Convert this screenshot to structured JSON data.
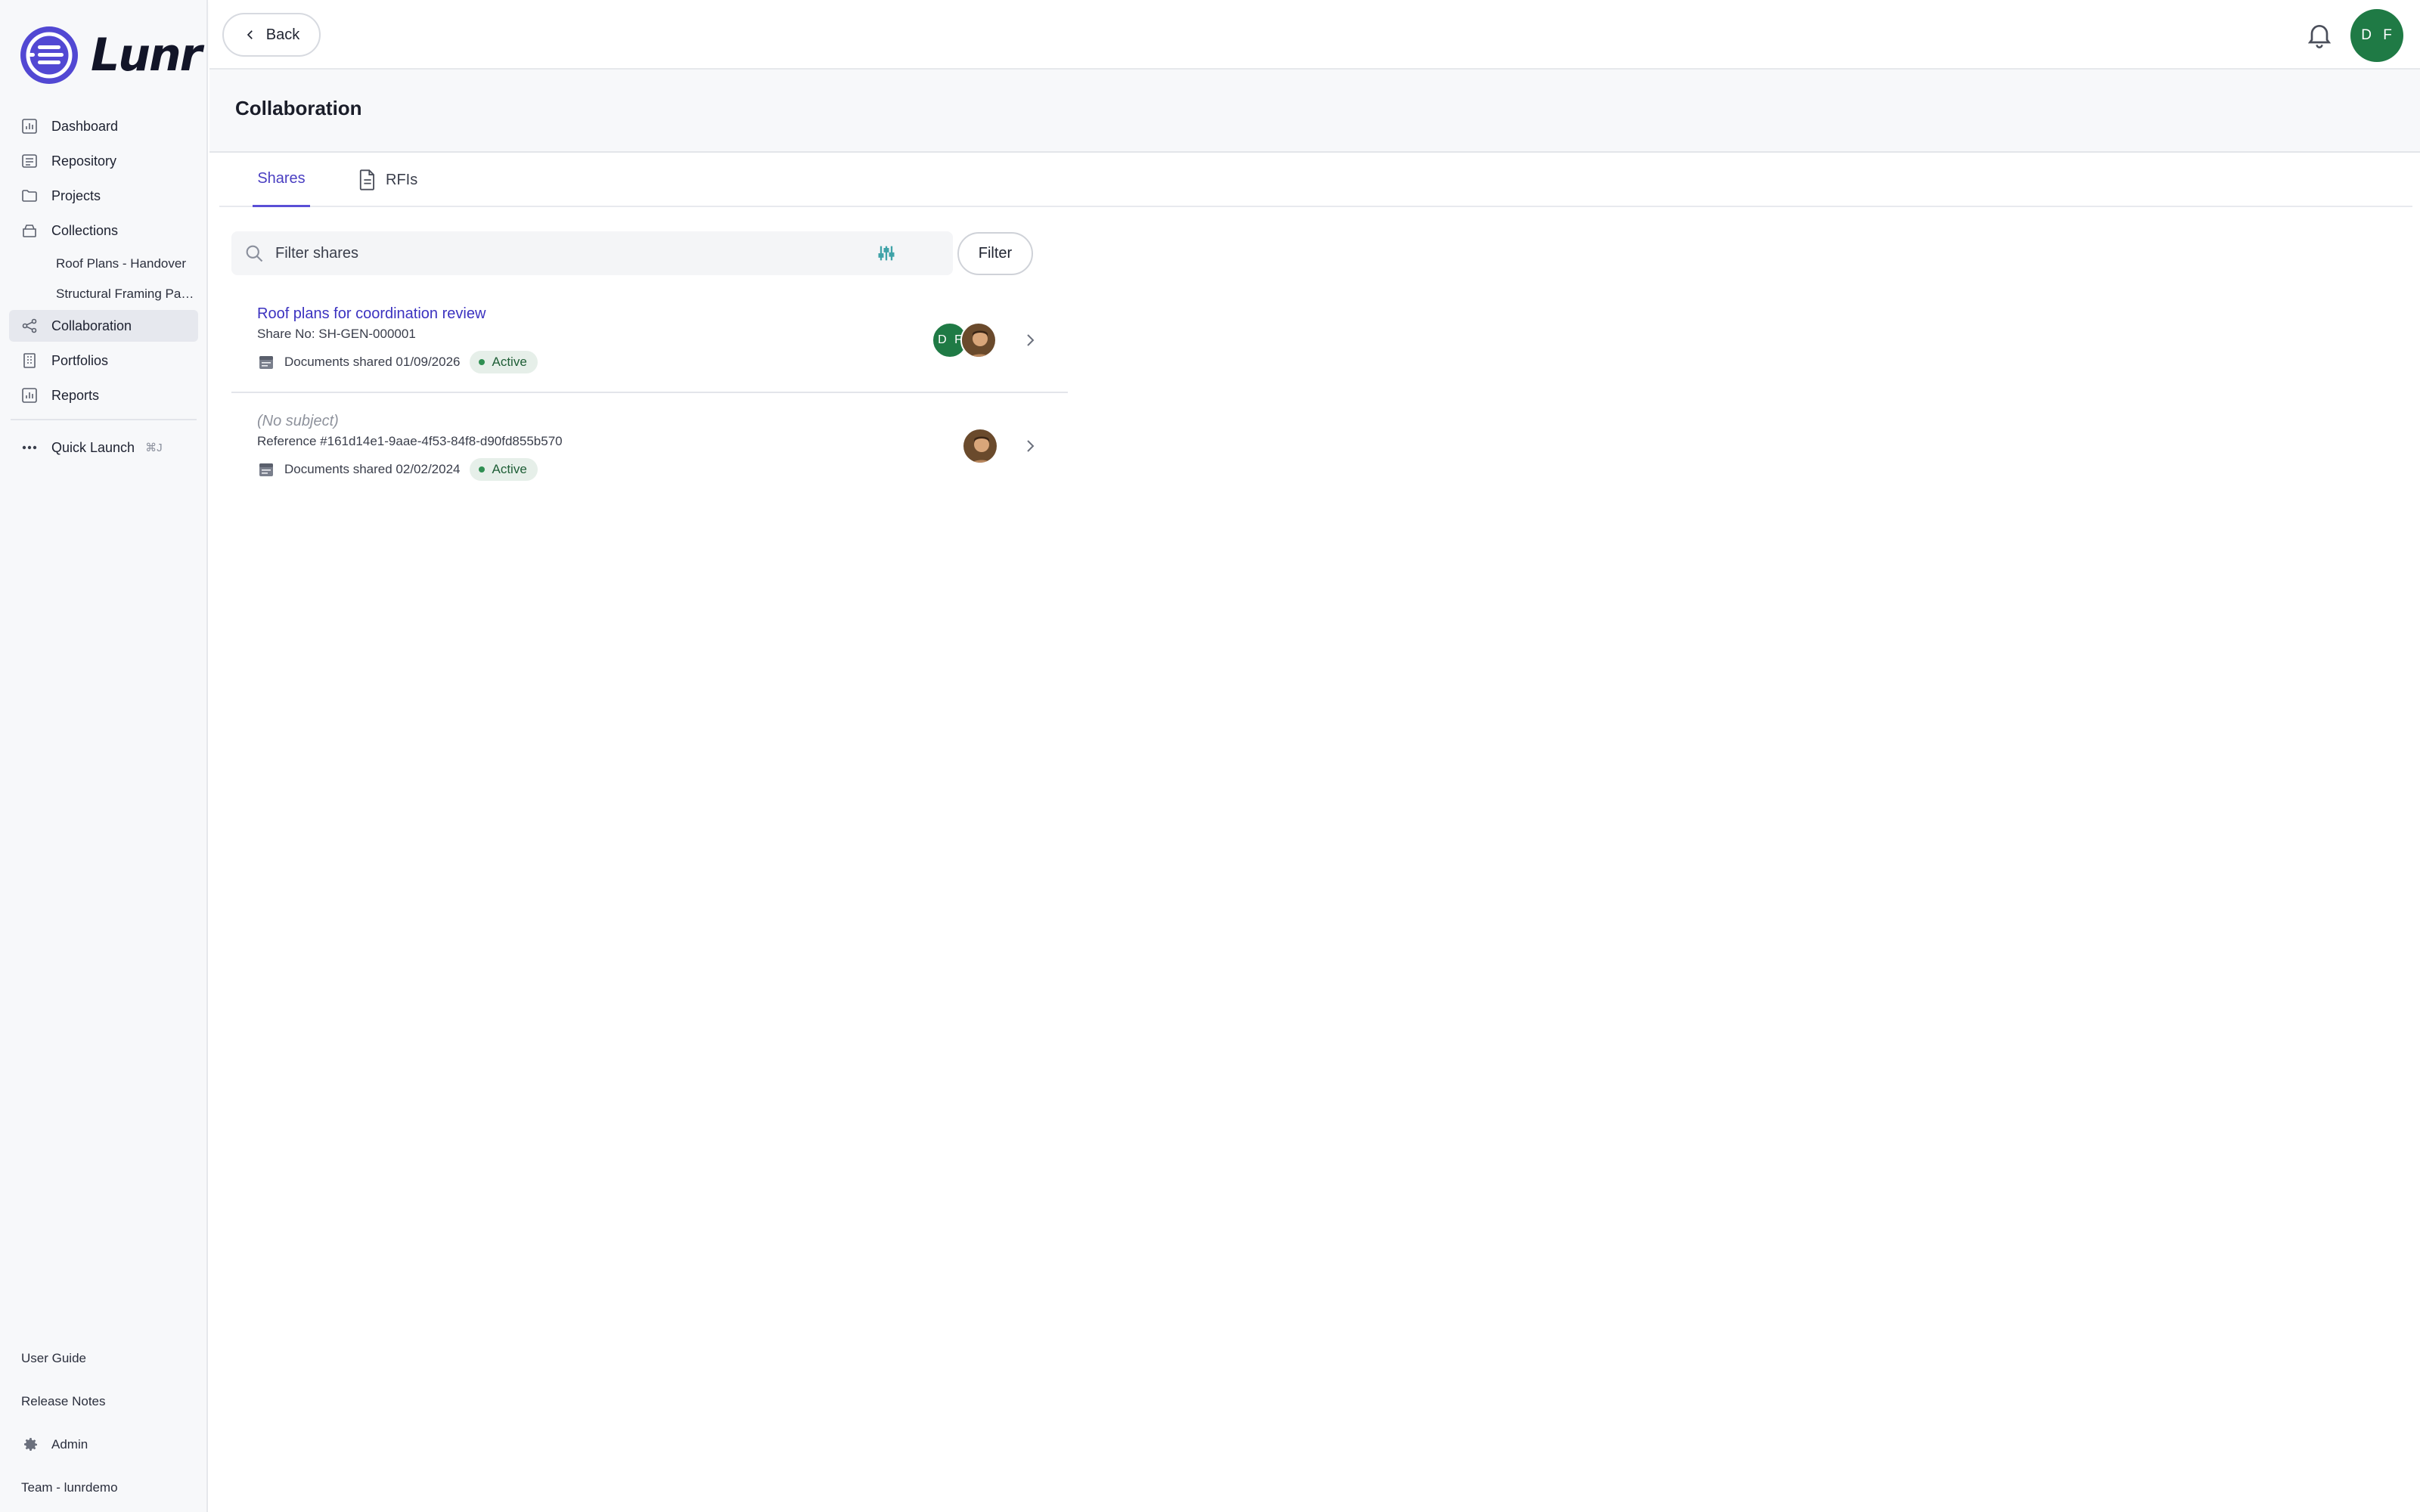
{
  "brand": {
    "name": "Lunr",
    "accent": "#5a4fd6",
    "logo_color": "#5248d3"
  },
  "sidebar": {
    "items": [
      {
        "label": "Dashboard",
        "icon": "chart-icon"
      },
      {
        "label": "Repository",
        "icon": "repository-icon"
      },
      {
        "label": "Projects",
        "icon": "folder-icon"
      },
      {
        "label": "Collections",
        "icon": "collection-icon"
      },
      {
        "label": "Collaboration",
        "icon": "share-icon",
        "active": true
      },
      {
        "label": "Portfolios",
        "icon": "building-icon"
      },
      {
        "label": "Reports",
        "icon": "chart-icon"
      }
    ],
    "collections": [
      "Roof Plans - Handover",
      "Structural Framing Package"
    ],
    "quick_launch": {
      "label": "Quick Launch",
      "shortcut": "⌘J"
    },
    "bottom": {
      "user_guide": "User Guide",
      "release_notes": "Release Notes",
      "admin": "Admin",
      "team": "Team - lunrdemo"
    }
  },
  "topbar": {
    "back_label": "Back",
    "user_initials": "D F",
    "avatar_color": "#1f7a45"
  },
  "page": {
    "title": "Collaboration"
  },
  "tabs": [
    {
      "label": "Shares",
      "active": true
    },
    {
      "label": "RFIs",
      "active": false
    }
  ],
  "filter": {
    "placeholder": "Filter shares",
    "value": "",
    "button_label": "Filter"
  },
  "shares": [
    {
      "title": "Roof plans for coordination review",
      "reference": "Share No: SH-GEN-000001",
      "meta": "Documents shared 01/09/2026",
      "status": "Active",
      "participants": [
        "D F",
        "photo"
      ]
    },
    {
      "title": "(No subject)",
      "reference": "Reference #161d14e1-9aae-4f53-84f8-d90fd855b570",
      "meta": "Documents shared 02/02/2024",
      "status": "Active",
      "participants": [
        "photo"
      ]
    }
  ]
}
